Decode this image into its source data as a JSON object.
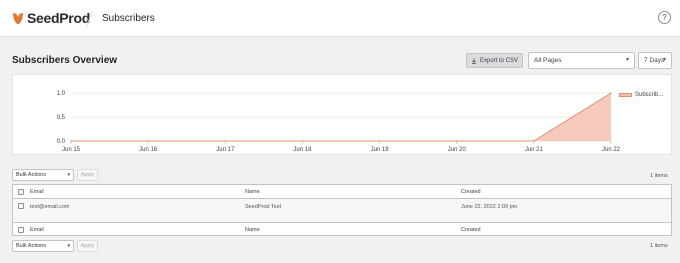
{
  "header": {
    "brand": "SeedProd",
    "page_title": "Subscribers",
    "help_glyph": "?"
  },
  "overview": {
    "title": "Subscribers Overview",
    "export_label": "Export to CSV",
    "page_filter": "All Pages",
    "range_filter": "7 Days"
  },
  "chart_data": {
    "type": "area",
    "x": [
      "Jun 15",
      "Jun 16",
      "Jun 17",
      "Jun 18",
      "Jun 19",
      "Jun 20",
      "Jun 21",
      "Jun 22"
    ],
    "y_ticks": [
      "1.0",
      "0.5",
      "0.0"
    ],
    "ylim": [
      0,
      1
    ],
    "series": [
      {
        "name": "Subscrib...",
        "values": [
          0,
          0,
          0,
          0,
          0,
          0,
          0,
          1
        ],
        "color": "#f4c2b3",
        "line_color": "#e58e6c"
      }
    ],
    "legend_position": "top-right",
    "grid": true
  },
  "table_controls": {
    "bulk_label": "Bulk Actions",
    "apply_label": "Apply",
    "items_count": "1 items"
  },
  "table": {
    "columns": [
      "Email",
      "Name",
      "Created"
    ],
    "rows": [
      {
        "email": "test@email.com",
        "name": "SeedProd Test",
        "created": "June 22, 2022 2:09 pm"
      }
    ]
  },
  "colors": {
    "accent": "#e27730",
    "area": "#f4c2b3"
  }
}
